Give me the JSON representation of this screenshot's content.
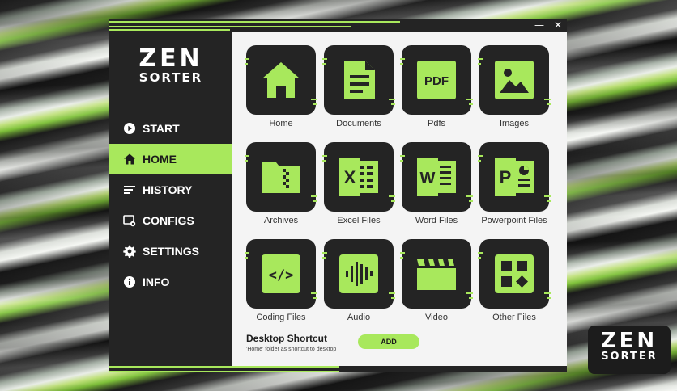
{
  "window": {
    "minimize_label": "—",
    "close_label": "✕"
  },
  "logo": {
    "line1": "ZEN",
    "line2": "SORTER"
  },
  "sidebar": {
    "items": [
      {
        "label": "START",
        "icon": "play-circle-icon"
      },
      {
        "label": "HOME",
        "icon": "home-icon",
        "active": true
      },
      {
        "label": "HISTORY",
        "icon": "list-icon"
      },
      {
        "label": "CONFIGS",
        "icon": "config-icon"
      },
      {
        "label": "SETTINGS",
        "icon": "gear-icon"
      },
      {
        "label": "INFO",
        "icon": "info-icon"
      }
    ]
  },
  "tiles": [
    {
      "label": "Home",
      "icon": "home-icon"
    },
    {
      "label": "Documents",
      "icon": "document-icon"
    },
    {
      "label": "Pdfs",
      "icon": "pdf-icon",
      "icon_text": "PDF"
    },
    {
      "label": "Images",
      "icon": "image-icon"
    },
    {
      "label": "Archives",
      "icon": "archive-icon"
    },
    {
      "label": "Excel Files",
      "icon": "excel-icon",
      "icon_text": "X"
    },
    {
      "label": "Word Files",
      "icon": "word-icon",
      "icon_text": "W"
    },
    {
      "label": "Powerpoint Files",
      "icon": "powerpoint-icon",
      "icon_text": "P"
    },
    {
      "label": "Coding Files",
      "icon": "code-icon",
      "icon_text": "</>"
    },
    {
      "label": "Audio",
      "icon": "audio-icon"
    },
    {
      "label": "Video",
      "icon": "video-icon"
    },
    {
      "label": "Other Files",
      "icon": "other-files-icon"
    }
  ],
  "shortcut": {
    "title": "Desktop Shortcut",
    "description": "'Home' folder as shortcut to desktop",
    "button_label": "ADD"
  },
  "colors": {
    "accent": "#a8e85c",
    "dark": "#242424",
    "panel": "#f4f4f4"
  }
}
